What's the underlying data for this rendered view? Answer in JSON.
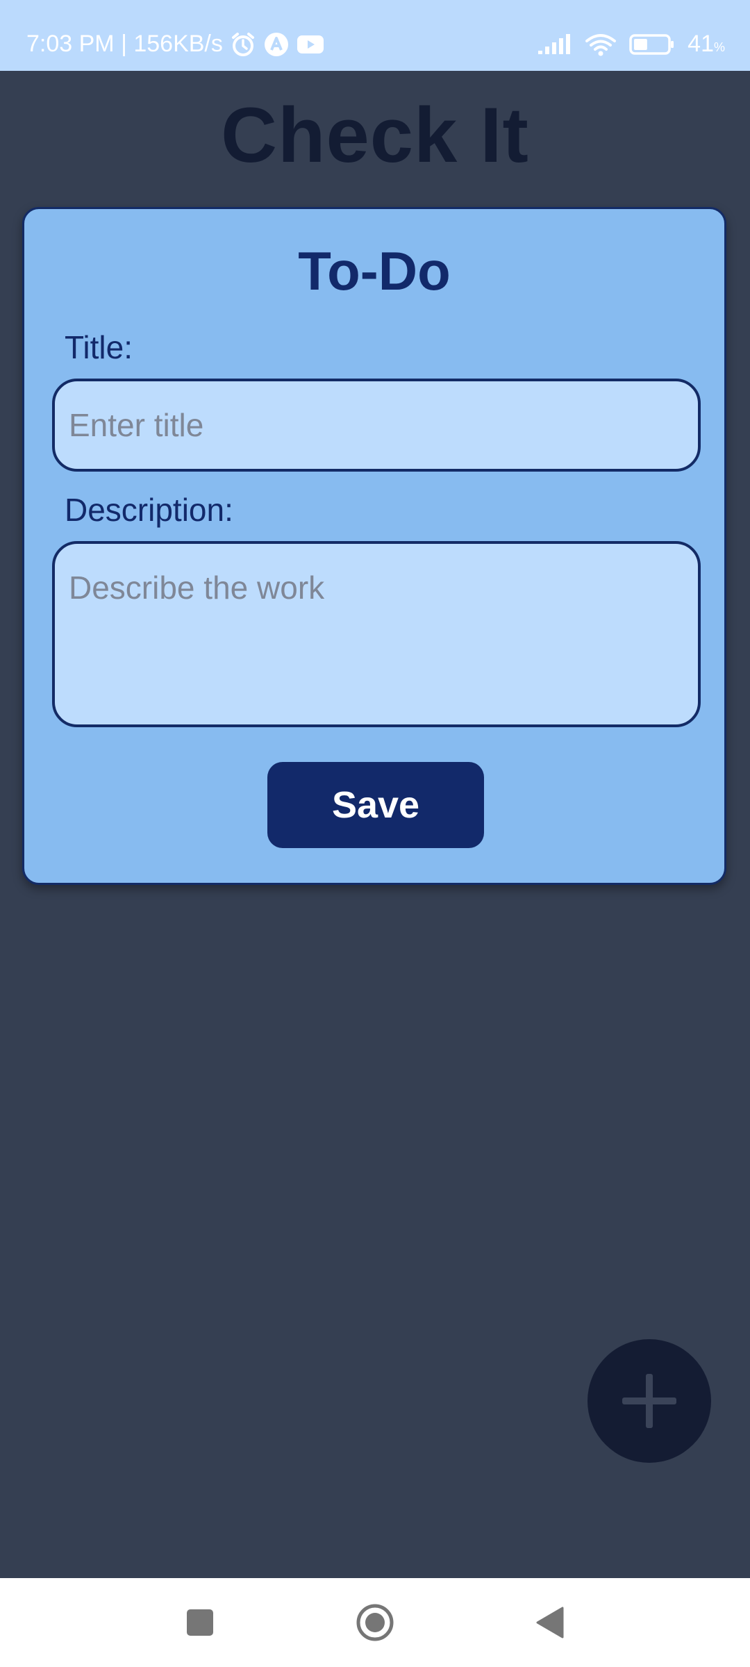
{
  "status_bar": {
    "time_speed": "7:03 PM | 156KB/s",
    "battery_percent": "41",
    "battery_unit": "%",
    "battery_level": 0.41,
    "icons": [
      "alarm-icon",
      "app-a-icon",
      "youtube-icon",
      "signal-icon",
      "wifi-icon",
      "battery-icon"
    ]
  },
  "app": {
    "title": "Check It"
  },
  "dialog": {
    "heading": "To-Do",
    "title_label": "Title:",
    "title_placeholder": "Enter title",
    "title_value": "",
    "description_label": "Description:",
    "description_placeholder": "Describe the work",
    "description_value": "",
    "save_label": "Save"
  },
  "fab": {
    "icon": "plus-icon"
  },
  "nav_bar": {
    "buttons": [
      "recents-icon",
      "home-icon",
      "back-icon"
    ]
  },
  "colors": {
    "status_bar_bg": "#bbdafd",
    "background": "#353f52",
    "card_bg": "#87bbf0",
    "input_bg": "#bddcfd",
    "accent": "#12296a",
    "fab_bg": "#141c33"
  }
}
